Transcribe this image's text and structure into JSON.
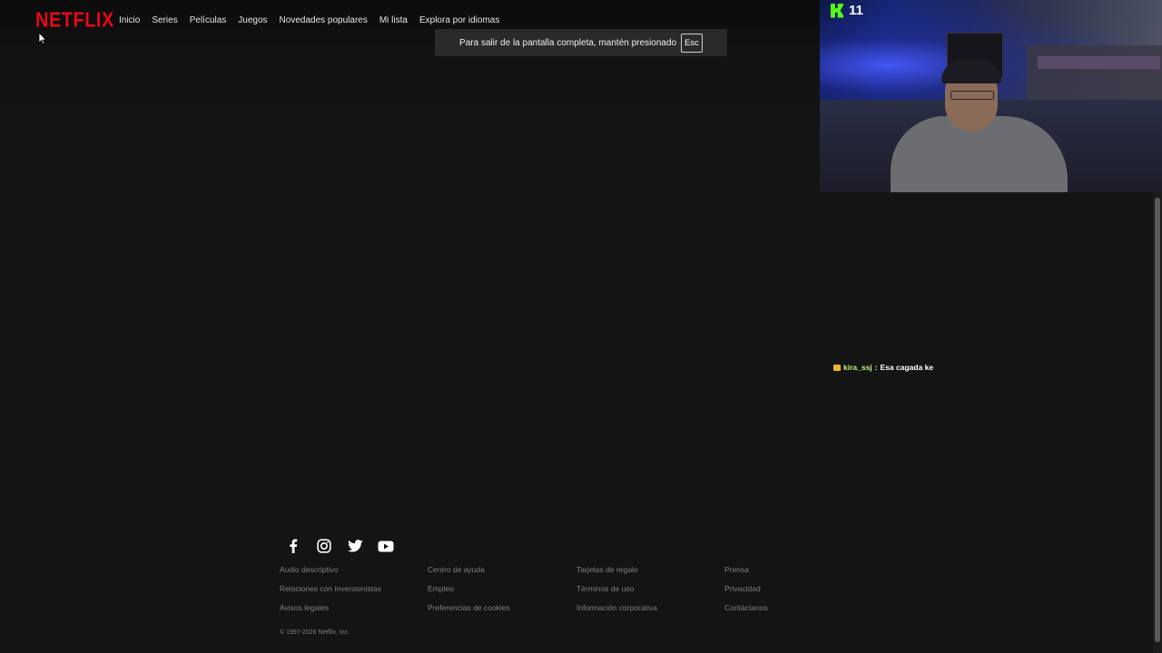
{
  "header": {
    "logo": "NETFLIX",
    "nav": [
      "Inicio",
      "Series",
      "Películas",
      "Juegos",
      "Novedades populares",
      "Mi lista",
      "Explora por idiomas"
    ]
  },
  "toast": {
    "message": "Para salir de la pantalla completa, mantén presionado",
    "key": "Esc"
  },
  "stream_overlay": {
    "viewer_count": "11",
    "chat": {
      "user": "kira_ssj",
      "separator": ":",
      "message": "Esa cagada ke"
    },
    "colors": {
      "kick_green": "#53fc18",
      "chat_user": "#bff67a"
    }
  },
  "footer": {
    "social_icons": [
      "facebook-icon",
      "instagram-icon",
      "twitter-icon",
      "youtube-icon"
    ],
    "links": [
      "Audio descriptivo",
      "Centro de ayuda",
      "Tarjetas de regalo",
      "Prensa",
      "Relaciones con inversionistas",
      "Empleo",
      "Términos de uso",
      "Privacidad",
      "Avisos legales",
      "Preferencias de cookies",
      "Información corporativa",
      "Contáctanos"
    ],
    "copyright": "© 1997-2026 Netflix, Inc."
  },
  "colors": {
    "brand": "#e50914",
    "background": "#141414",
    "link": "#808080"
  }
}
